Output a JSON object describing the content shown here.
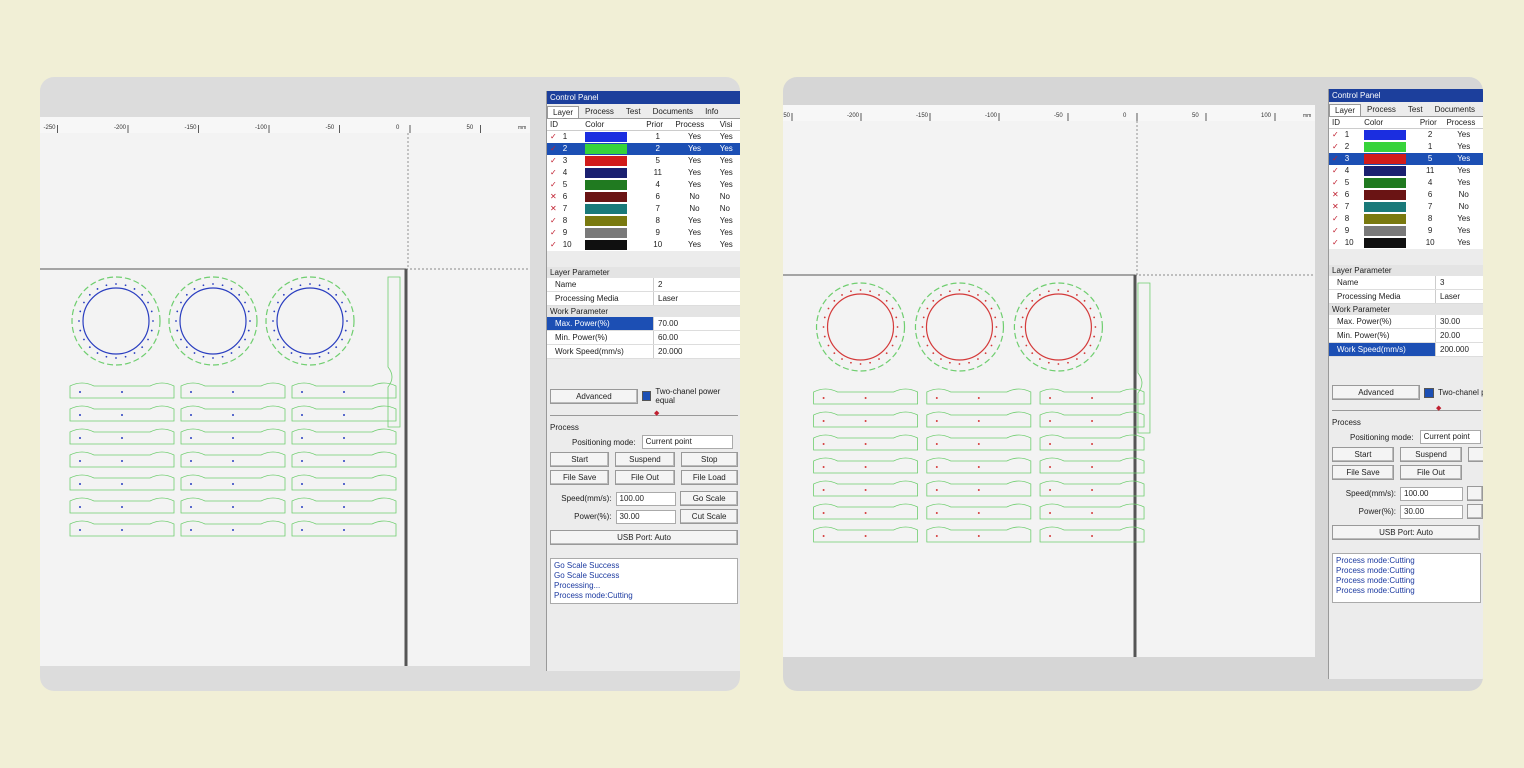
{
  "colors": {
    "accent": "#1c4fb4",
    "shape_green": "#6fce6f",
    "shape_blue": "#2a3ec0",
    "shape_red": "#d43a3a"
  },
  "common": {
    "control_panel_title": "Control Panel",
    "tabs": [
      "Layer",
      "Process",
      "Test",
      "Documents",
      "Info"
    ],
    "table_headers": {
      "id": "ID",
      "color": "Color",
      "prior": "Prior",
      "process": "Process",
      "visible": "Visi"
    },
    "layer_parameter_header": "Layer Parameter",
    "work_parameter_header": "Work Parameter",
    "name_label": "Name",
    "media_label": "Processing Media",
    "max_power_label": "Max. Power(%)",
    "min_power_label": "Min. Power(%)",
    "work_speed_label": "Work Speed(mm/s)",
    "advanced_label": "Advanced",
    "two_channel_label": "Two-chanel power equal",
    "process_group_label": "Process",
    "positioning_label": "Positioning mode:",
    "positioning_value": "Current point",
    "start_label": "Start",
    "suspend_label": "Suspend",
    "stop_label": "Stop",
    "file_save_label": "File Save",
    "file_out_label": "File Out",
    "file_load_label": "File Load",
    "speed_label": "Speed(mm/s):",
    "power_label": "Power(%):",
    "go_scale_label": "Go Scale",
    "cut_scale_label": "Cut Scale",
    "usb_label": "USB Port: Auto",
    "ruler_unit": "mm",
    "ruler_labels": [
      "-250",
      "-200",
      "-150",
      "-100",
      "-50",
      "0",
      "50",
      "100"
    ]
  },
  "left": {
    "layers": [
      {
        "id": "1",
        "color": "#1b2ee0",
        "prior": "1",
        "process": "Yes",
        "check": "✓"
      },
      {
        "id": "2",
        "color": "#37d33a",
        "prior": "2",
        "process": "Yes",
        "check": "✓"
      },
      {
        "id": "3",
        "color": "#d11b1b",
        "prior": "5",
        "process": "Yes",
        "check": "✓"
      },
      {
        "id": "4",
        "color": "#1a2070",
        "prior": "11",
        "process": "Yes",
        "check": "✓"
      },
      {
        "id": "5",
        "color": "#207a20",
        "prior": "4",
        "process": "Yes",
        "check": "✓"
      },
      {
        "id": "6",
        "color": "#6a1414",
        "prior": "6",
        "process": "No",
        "check": "✕"
      },
      {
        "id": "7",
        "color": "#1a7a7a",
        "prior": "7",
        "process": "No",
        "check": "✕"
      },
      {
        "id": "8",
        "color": "#7a7a10",
        "prior": "8",
        "process": "Yes",
        "check": "✓"
      },
      {
        "id": "9",
        "color": "#7a7a7a",
        "prior": "9",
        "process": "Yes",
        "check": "✓"
      },
      {
        "id": "10",
        "color": "#101010",
        "prior": "10",
        "process": "Yes",
        "check": "✓"
      }
    ],
    "selected_row": 1,
    "layer_name": "2",
    "media": "Laser",
    "max_power": "70.00",
    "min_power": "60.00",
    "work_speed": "20.000",
    "selected_param": "max",
    "speed_value": "100.00",
    "power_value": "30.00",
    "log": [
      "Go Scale Success",
      "Go Scale Success",
      "Processing...",
      "Process mode:Cutting"
    ]
  },
  "right": {
    "layers": [
      {
        "id": "1",
        "color": "#1b2ee0",
        "prior": "2",
        "process": "Yes",
        "check": "✓"
      },
      {
        "id": "2",
        "color": "#37d33a",
        "prior": "1",
        "process": "Yes",
        "check": "✓"
      },
      {
        "id": "3",
        "color": "#d11b1b",
        "prior": "5",
        "process": "Yes",
        "check": "✓"
      },
      {
        "id": "4",
        "color": "#1a2070",
        "prior": "11",
        "process": "Yes",
        "check": "✓"
      },
      {
        "id": "5",
        "color": "#207a20",
        "prior": "4",
        "process": "Yes",
        "check": "✓"
      },
      {
        "id": "6",
        "color": "#6a1414",
        "prior": "6",
        "process": "No",
        "check": "✕"
      },
      {
        "id": "7",
        "color": "#1a7a7a",
        "prior": "7",
        "process": "No",
        "check": "✕"
      },
      {
        "id": "8",
        "color": "#7a7a10",
        "prior": "8",
        "process": "Yes",
        "check": "✓"
      },
      {
        "id": "9",
        "color": "#7a7a7a",
        "prior": "9",
        "process": "Yes",
        "check": "✓"
      },
      {
        "id": "10",
        "color": "#101010",
        "prior": "10",
        "process": "Yes",
        "check": "✓"
      }
    ],
    "selected_row": 2,
    "layer_name": "3",
    "media": "Laser",
    "max_power": "30.00",
    "min_power": "20.00",
    "work_speed": "200.000",
    "selected_param": "speed",
    "speed_value": "100.00",
    "power_value": "30.00",
    "log": [
      "Process mode:Cutting",
      "Process mode:Cutting",
      "Process mode:Cutting",
      "Process mode:Cutting"
    ]
  }
}
